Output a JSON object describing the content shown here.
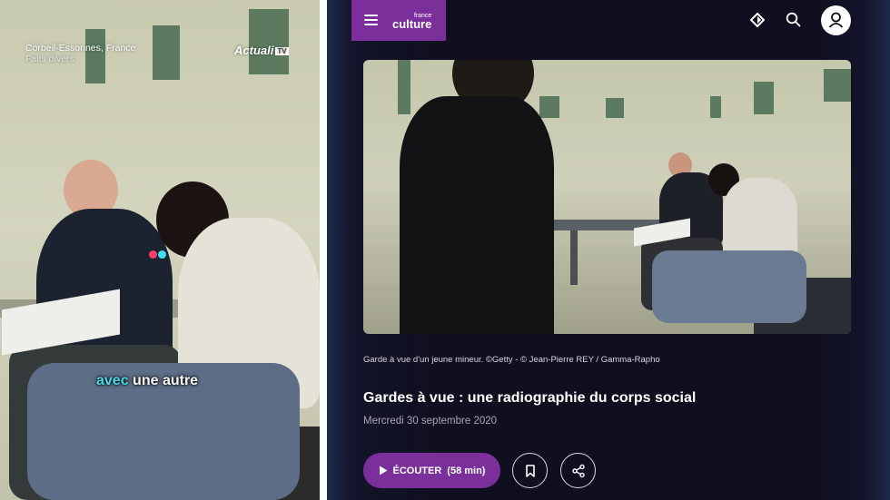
{
  "left_video": {
    "location": "Corbeil-Essonnes, France",
    "category": "Faits divers",
    "source_logo": "Actuali",
    "source_logo_tv": "TV",
    "subtitle_highlight": "avec",
    "subtitle_rest": "une autre"
  },
  "header": {
    "logo_small": "france",
    "logo_main": "culture",
    "icons": [
      "menu-icon",
      "diamond-icon",
      "search-icon",
      "user-icon"
    ]
  },
  "article": {
    "photo_credit": "Garde à vue d'un jeune mineur. ©Getty - © Jean-Pierre REY / Gamma-Rapho",
    "title": "Gardes à vue : une radiographie du corps social",
    "date": "Mercredi 30 septembre 2020",
    "listen_label": "ÉCOUTER",
    "listen_duration": "(58 min)"
  },
  "colors": {
    "brand_purple": "#7a2f9a",
    "background": "#0f0f20",
    "subtitle_highlight": "#4ad8e8"
  }
}
